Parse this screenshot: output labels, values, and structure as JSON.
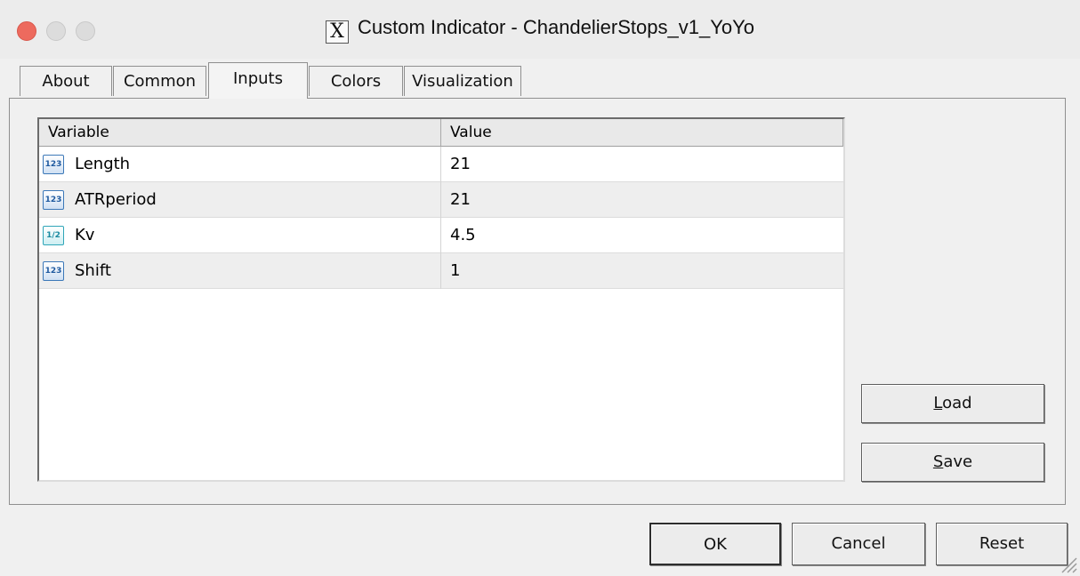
{
  "window": {
    "title": "Custom Indicator - ChandelierStops_v1_YoYo",
    "title_icon_glyph": "X",
    "traffic_lights": [
      "close",
      "minimize",
      "zoom"
    ]
  },
  "tabs": [
    {
      "label": "About",
      "active": false
    },
    {
      "label": "Common",
      "active": false
    },
    {
      "label": "Inputs",
      "active": true
    },
    {
      "label": "Colors",
      "active": false
    },
    {
      "label": "Visualization",
      "active": false
    }
  ],
  "table": {
    "headers": {
      "variable": "Variable",
      "value": "Value"
    },
    "rows": [
      {
        "icon": "integer-icon",
        "icon_glyph": "123",
        "name": "Length",
        "value": "21"
      },
      {
        "icon": "integer-icon",
        "icon_glyph": "123",
        "name": "ATRperiod",
        "value": "21"
      },
      {
        "icon": "double-icon",
        "icon_glyph": "1/2",
        "name": "Kv",
        "value": "4.5"
      },
      {
        "icon": "integer-icon",
        "icon_glyph": "123",
        "name": "Shift",
        "value": "1"
      }
    ]
  },
  "side_buttons": {
    "load": {
      "prefix": "",
      "mnemonic": "L",
      "rest": "oad"
    },
    "save": {
      "prefix": "",
      "mnemonic": "S",
      "rest": "ave"
    }
  },
  "footer_buttons": {
    "ok": "OK",
    "cancel": "Cancel",
    "reset": "Reset"
  },
  "colors": {
    "close_light": "#ed6a5e",
    "inactive_light": "#dcdcdc",
    "row_alt": "#eeeeee",
    "header_bg": "#e9e9e9"
  }
}
